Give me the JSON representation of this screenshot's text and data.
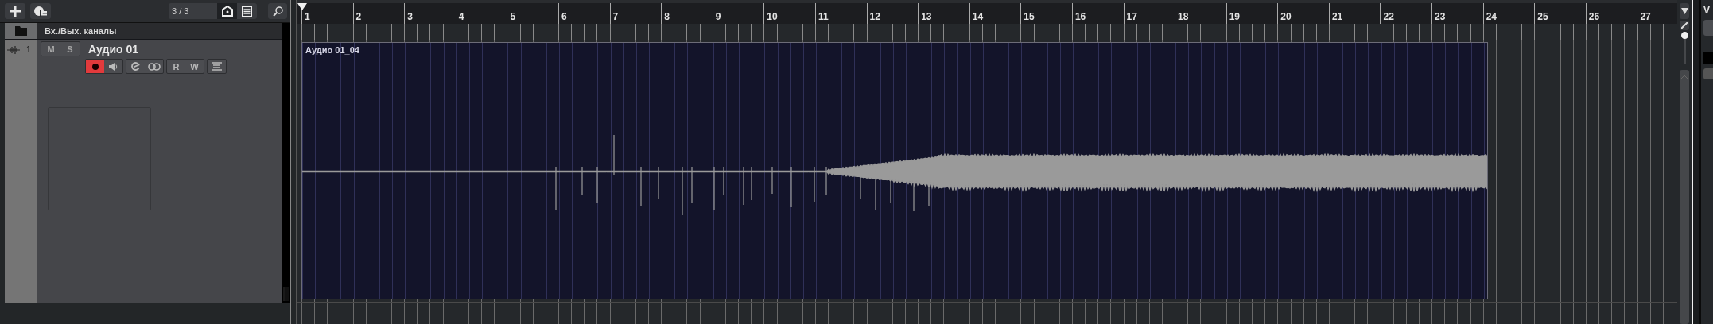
{
  "toolbar": {
    "counter": "3 / 3"
  },
  "folder_track": {
    "name": "Вх./Вых. каналы"
  },
  "track": {
    "number": "1",
    "name": "Аудио 01",
    "buttons": [
      {
        "label": "M",
        "on": false
      },
      {
        "label": "S",
        "on": false
      }
    ],
    "control_groups": [
      [
        {
          "kind": "record",
          "on": true
        },
        {
          "kind": "monitor",
          "on": false
        }
      ],
      [
        {
          "kind": "edit"
        },
        {
          "kind": "link"
        }
      ],
      [
        {
          "kind": "read",
          "label": "R",
          "on": false
        },
        {
          "kind": "write",
          "label": "W",
          "on": false
        }
      ],
      [
        {
          "kind": "list"
        }
      ]
    ]
  },
  "ruler": {
    "bars": [
      "1",
      "2",
      "3",
      "4",
      "5",
      "6",
      "7",
      "8",
      "9",
      "10",
      "11",
      "12",
      "13",
      "14",
      "15",
      "16",
      "17",
      "18",
      "19",
      "20",
      "21",
      "22",
      "23",
      "24",
      "25",
      "26",
      "27"
    ]
  },
  "event": {
    "name": "Аудио 01_04"
  },
  "zoom_slider": {
    "level": 0.9
  },
  "right_panel": {
    "title": "V"
  }
}
